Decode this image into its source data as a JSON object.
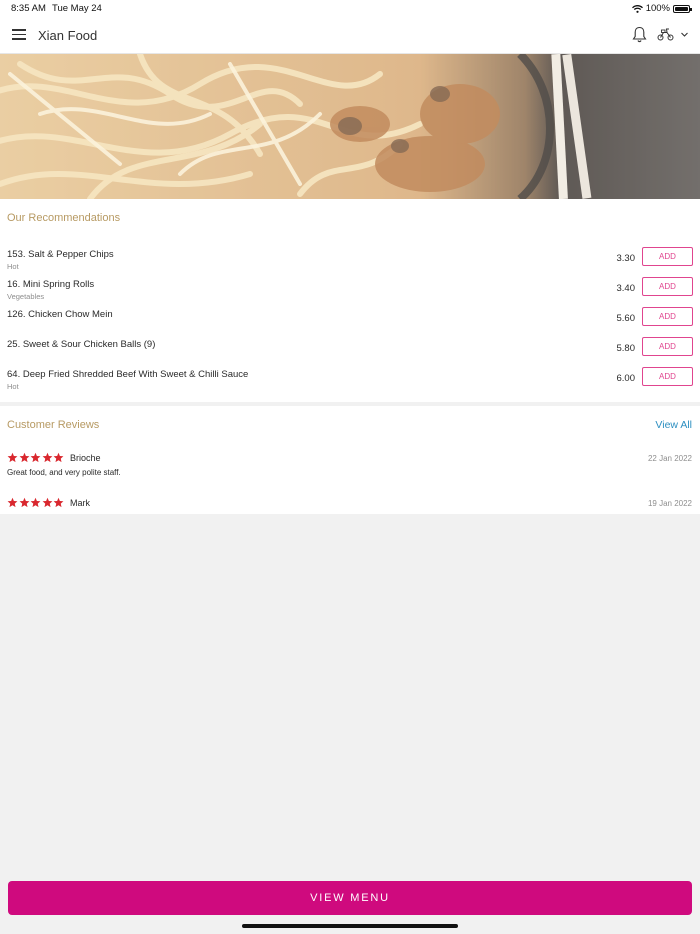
{
  "status": {
    "time": "8:35 AM",
    "date": "Tue May 24",
    "battery": "100%"
  },
  "header": {
    "title": "Xian Food"
  },
  "icons": {
    "menu": "hamburger-menu-icon",
    "notifications": "bell-icon",
    "delivery": "moped-icon",
    "dropdown": "chevron-down-icon"
  },
  "recommendations": {
    "title": "Our Recommendations",
    "add_label": "ADD",
    "items": [
      {
        "name": "153. Salt & Pepper Chips",
        "sub": "Hot",
        "price": "3.30"
      },
      {
        "name": "16. Mini Spring Rolls",
        "sub": "Vegetables",
        "price": "3.40"
      },
      {
        "name": "126. Chicken Chow Mein",
        "sub": "",
        "price": "5.60"
      },
      {
        "name": "25. Sweet & Sour Chicken Balls (9)",
        "sub": "",
        "price": "5.80"
      },
      {
        "name": "64. Deep Fried Shredded Beef With Sweet & Chilli Sauce",
        "sub": "Hot",
        "price": "6.00"
      }
    ]
  },
  "reviews": {
    "title": "Customer Reviews",
    "view_all": "View All",
    "items": [
      {
        "name": "Brioche",
        "date": "22 Jan 2022",
        "text": "Great food, and very polite staff.",
        "rating": 5
      },
      {
        "name": "Mark",
        "date": "19 Jan 2022",
        "text": "",
        "rating": 5
      }
    ]
  },
  "footer": {
    "button": "VIEW MENU"
  },
  "colors": {
    "accent": "#cf0a7e",
    "add_button": "#e0458f",
    "section_title": "#b79a63",
    "link": "#2d8fc1",
    "star": "#d9272e"
  }
}
